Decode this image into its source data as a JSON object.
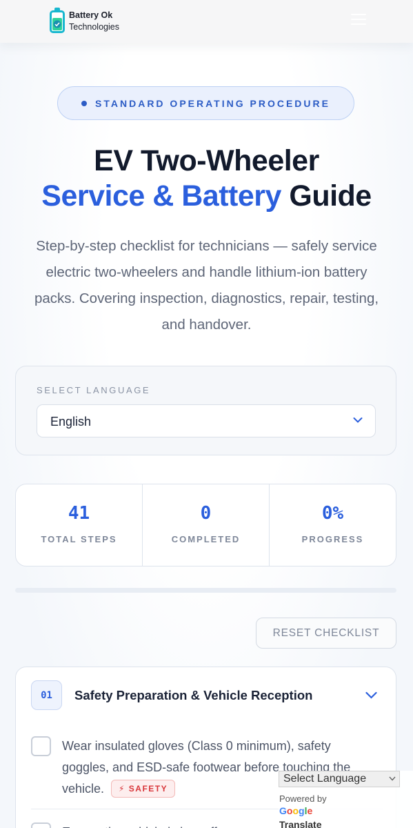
{
  "brand": {
    "name_line1": "Battery Ok",
    "name_line2": "Technologies"
  },
  "hero": {
    "eyebrow": "STANDARD OPERATING PROCEDURE",
    "title_line1": "EV Two-Wheeler",
    "title_accent": "Service & Battery",
    "title_rest": "Guide",
    "subtitle": "Step-by-step checklist for technicians — safely service electric two-wheelers and handle lithium-ion battery packs. Covering inspection, diagnostics, repair, testing, and handover."
  },
  "language": {
    "label": "SELECT LANGUAGE",
    "selected": "English"
  },
  "stats": {
    "total_steps_value": "41",
    "total_steps_label": "TOTAL STEPS",
    "completed_value": "0",
    "completed_label": "COMPLETED",
    "progress_value": "0%",
    "progress_label": "PROGRESS",
    "progress_fraction": 0
  },
  "actions": {
    "reset_label": "RESET CHECKLIST"
  },
  "sections": [
    {
      "number": "01",
      "title": "Safety Preparation & Vehicle Reception",
      "items": [
        {
          "text": "Wear insulated gloves (Class 0 minimum), safety goggles, and ESD-safe footwear before touching the vehicle.",
          "tag": "⚡ SAFETY"
        },
        {
          "text": "Ensure the vehicle is key-off",
          "tag": ""
        }
      ]
    }
  ],
  "translate_widget": {
    "select_label": "Select Language",
    "powered_by": "Powered by",
    "google": "Google",
    "translate": "Translate"
  },
  "colors": {
    "accent": "#2b5fdd",
    "danger": "#d9363a",
    "brand_cyan": "#18b7cf",
    "brand_green": "#2fd29a"
  },
  "icons": [
    "battery-check-logo-icon",
    "hamburger-menu-icon",
    "chevron-down-icon",
    "lightning-icon"
  ]
}
